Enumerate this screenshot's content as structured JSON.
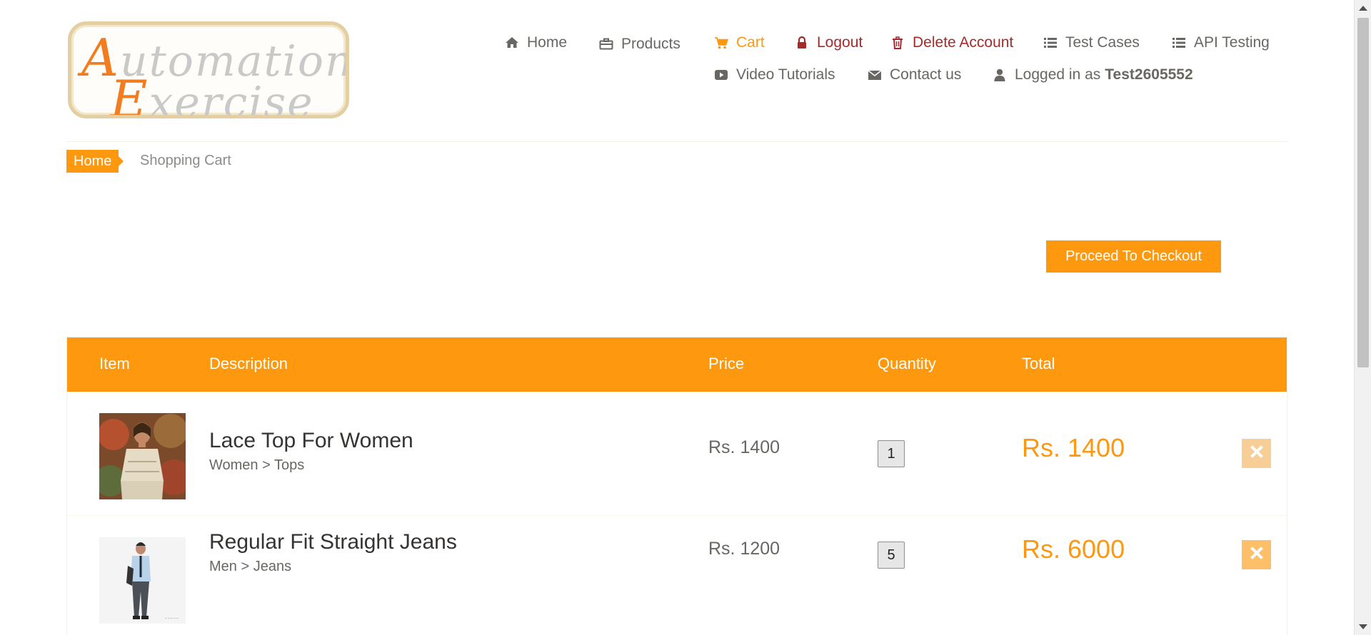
{
  "logo": {
    "line1_cap": "A",
    "line1_rest": "utomation",
    "line2_cap": "E",
    "line2_rest": "xercise"
  },
  "nav": {
    "home": "Home",
    "products": "Products",
    "cart": "Cart",
    "logout": "Logout",
    "delete_account": "Delete Account",
    "test_cases": "Test Cases",
    "api_testing": "API Testing",
    "video_tutorials": "Video Tutorials",
    "contact_us": "Contact us",
    "logged_in_prefix": "Logged in as",
    "username": "Test2605552"
  },
  "breadcrumb": {
    "home": "Home",
    "current": "Shopping Cart"
  },
  "checkout_button": "Proceed To Checkout",
  "table": {
    "headers": {
      "item": "Item",
      "description": "Description",
      "price": "Price",
      "quantity": "Quantity",
      "total": "Total"
    },
    "rows": [
      {
        "name": "Lace Top For Women",
        "category": "Women > Tops",
        "price": "Rs. 1400",
        "quantity": "1",
        "total": "Rs. 1400"
      },
      {
        "name": "Regular Fit Straight Jeans",
        "category": "Men > Jeans",
        "price": "Rs. 1200",
        "quantity": "5",
        "total": "Rs. 6000"
      }
    ]
  },
  "colors": {
    "accent": "#fe980f",
    "danger": "#a52a2a",
    "text": "#696763"
  },
  "icons": [
    "home-icon",
    "briefcase-icon",
    "cart-icon",
    "lock-icon",
    "trash-icon",
    "list-icon",
    "video-icon",
    "envelope-icon",
    "user-icon",
    "close-icon"
  ]
}
